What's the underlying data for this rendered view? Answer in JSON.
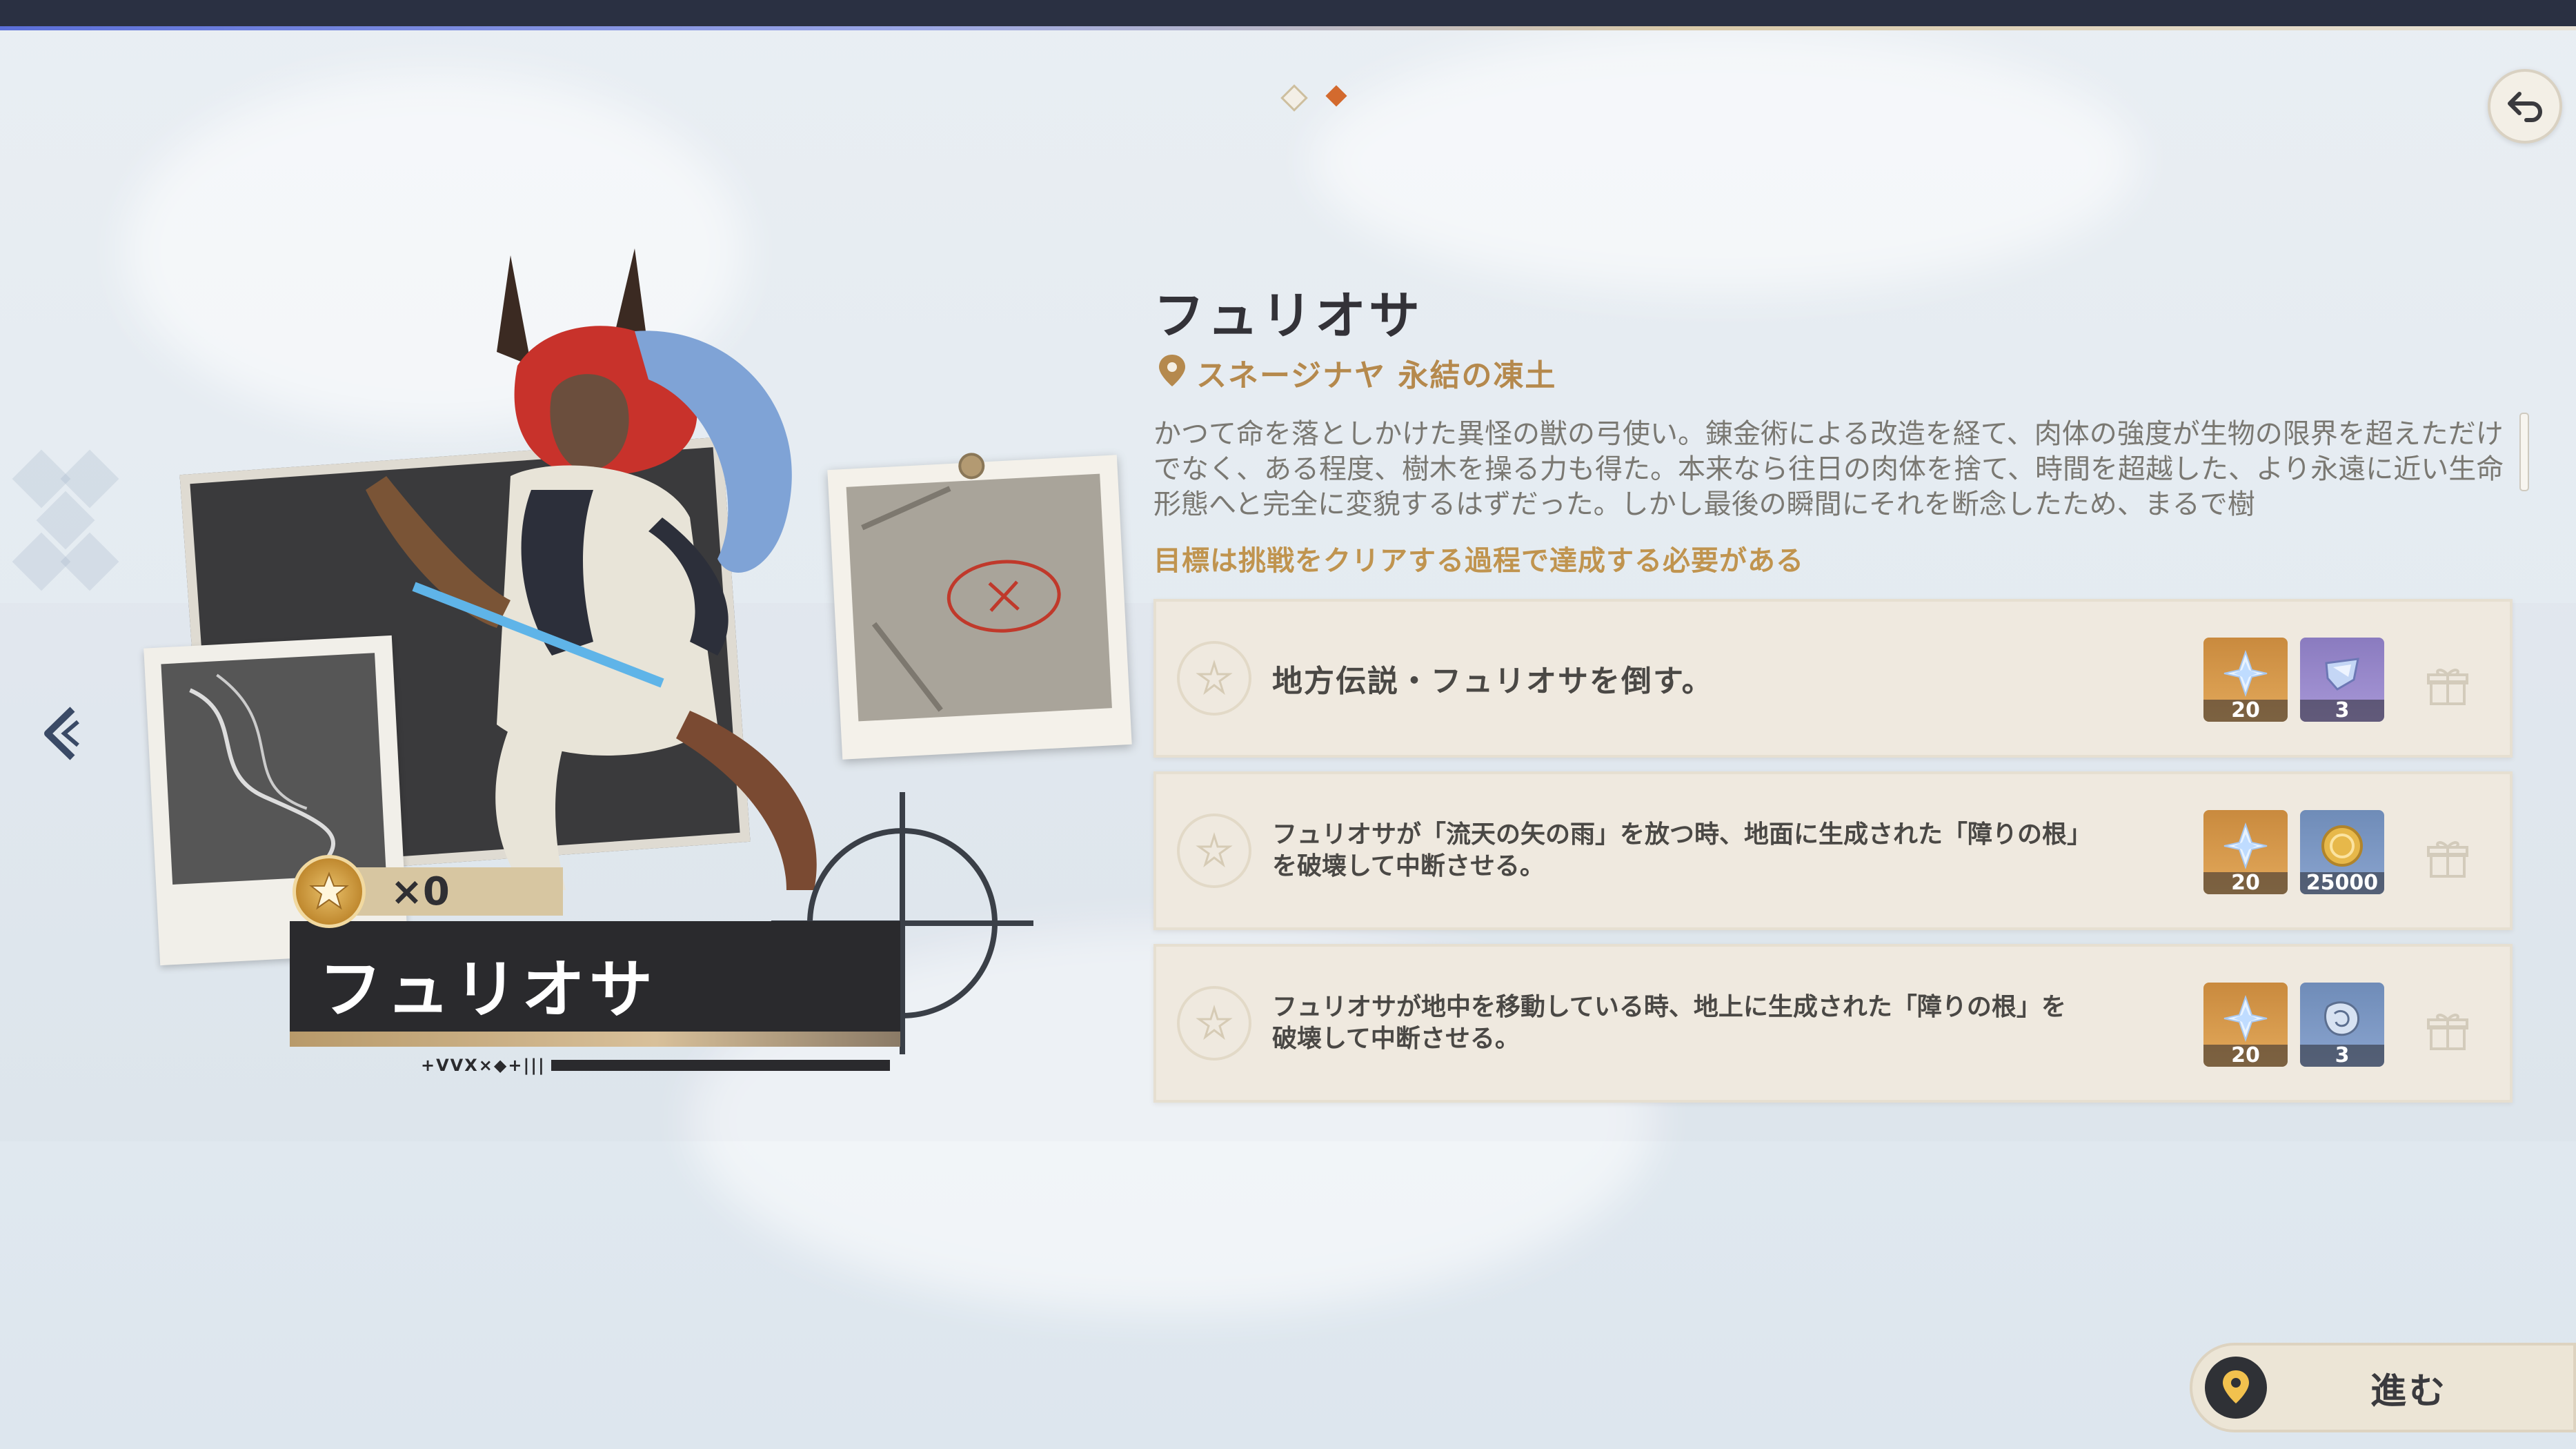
{
  "header": {
    "pager_total": 2,
    "pager_active_index": 1
  },
  "character": {
    "medal_count": "×0",
    "name_plate": "フュリオサ",
    "barcode_text": "+VVX×◆+|||"
  },
  "detail": {
    "title": "フュリオサ",
    "location": "スネージナヤ 永結の凍土",
    "description": "かつて命を落としかけた異怪の獣の弓使い。錬金術による改造を経て、肉体の強度が生物の限界を超えただけでなく、ある程度、樹木を操る力も得た。本来なら往日の肉体を捨て、時間を超越した、より永遠に近い生命形態へと完全に変貌するはずだった。しかし最後の瞬間にそれを断念したため、まるで樹",
    "goal_note": "目標は挑戦をクリアする過程で達成する必要がある"
  },
  "tasks": [
    {
      "text": "地方伝説・フュリオサを倒す。",
      "rewards": [
        {
          "icon": "primogem-icon",
          "qty": "20",
          "bg": "orange"
        },
        {
          "icon": "hero-wit-icon",
          "qty": "3",
          "bg": "purple"
        }
      ]
    },
    {
      "text": "フュリオサが「流天の矢の雨」を放つ時、地面に生成された「障りの根」を破壊して中断させる。",
      "rewards": [
        {
          "icon": "primogem-icon",
          "qty": "20",
          "bg": "orange"
        },
        {
          "icon": "mora-icon",
          "qty": "25000",
          "bg": "blue"
        }
      ]
    },
    {
      "text": "フュリオサが地中を移動している時、地上に生成された「障りの根」を破壊して中断させる。",
      "rewards": [
        {
          "icon": "primogem-icon",
          "qty": "20",
          "bg": "orange"
        },
        {
          "icon": "material-icon",
          "qty": "3",
          "bg": "blue"
        }
      ]
    }
  ],
  "footer": {
    "proceed_label": "進む"
  },
  "colors": {
    "accent_gold": "#b5894d",
    "pager_active": "#d36a2e",
    "panel": "#efe9df"
  }
}
